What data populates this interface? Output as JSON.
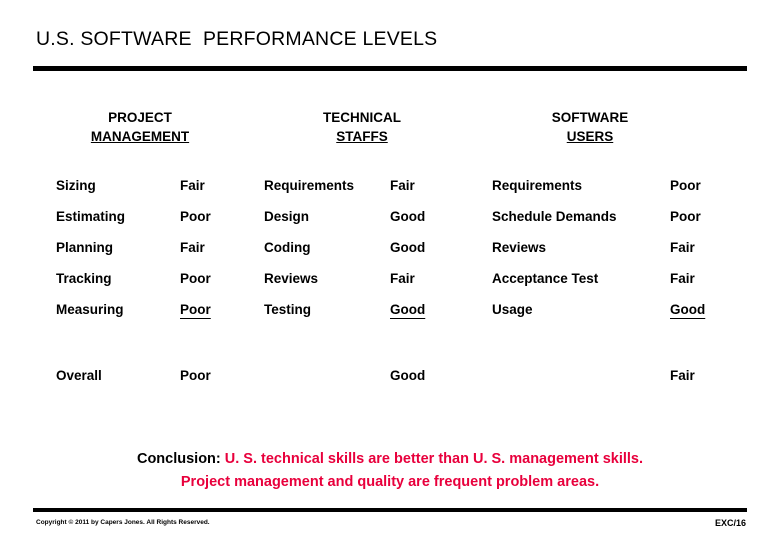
{
  "slide": {
    "title": "U.S. SOFTWARE  PERFORMANCE LEVELS",
    "copyright": "Copyright © 2011 by Capers Jones. All Rights Reserved.",
    "page_code": "EXC/16",
    "accent_color": "#e8003c"
  },
  "columns": {
    "project_management": {
      "line1": "PROJECT",
      "line2": "MANAGEMENT"
    },
    "technical_staffs": {
      "line1": "TECHNICAL",
      "line2": "STAFFS"
    },
    "software_users": {
      "line1": "SOFTWARE",
      "line2": "USERS"
    }
  },
  "rows": [
    {
      "pm_label": "Sizing",
      "pm_value": "Fair",
      "ts_label": "Requirements",
      "ts_value": "Fair",
      "su_label": "Requirements",
      "su_value": "Poor"
    },
    {
      "pm_label": "Estimating",
      "pm_value": "Poor",
      "ts_label": "Design",
      "ts_value": "Good",
      "su_label": "Schedule Demands",
      "su_value": "Poor"
    },
    {
      "pm_label": "Planning",
      "pm_value": "Fair",
      "ts_label": "Coding",
      "ts_value": "Good",
      "su_label": "Reviews",
      "su_value": "Fair"
    },
    {
      "pm_label": "Tracking",
      "pm_value": "Poor",
      "ts_label": "Reviews",
      "ts_value": "Fair",
      "su_label": "Acceptance Test",
      "su_value": "Fair"
    },
    {
      "pm_label": "Measuring",
      "pm_value": "Poor",
      "ts_label": "Testing",
      "ts_value": "Good",
      "su_label": "Usage",
      "su_value": "Good"
    }
  ],
  "overall": {
    "label": "Overall",
    "pm_value": "Poor",
    "ts_value": "Good",
    "su_value": "Fair"
  },
  "conclusion": {
    "lead": "Conclusion:",
    "line1": " U. S. technical skills are better than U. S. management skills.",
    "line2": "Project management and quality are frequent problem areas."
  }
}
